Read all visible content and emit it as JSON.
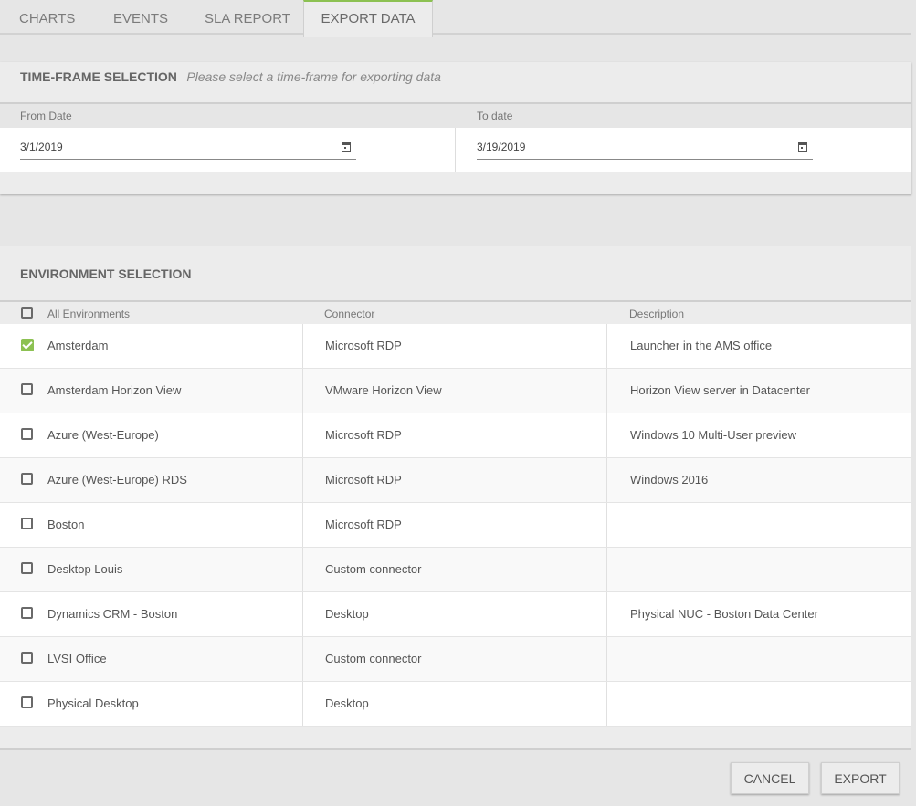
{
  "tabs": [
    {
      "label": "CHARTS"
    },
    {
      "label": "EVENTS"
    },
    {
      "label": "SLA REPORT"
    },
    {
      "label": "EXPORT DATA",
      "active": true
    }
  ],
  "time_frame": {
    "title": "TIME-FRAME SELECTION",
    "hint": "Please select a time-frame for exporting data",
    "from_label": "From Date",
    "from_value": "3/1/2019",
    "to_label": "To date",
    "to_value": "3/19/2019"
  },
  "environment": {
    "title": "ENVIRONMENT SELECTION",
    "columns": {
      "name": "All Environments",
      "connector": "Connector",
      "description": "Description"
    },
    "rows": [
      {
        "name": "Amsterdam",
        "connector": "Microsoft RDP",
        "description": "Launcher in the AMS office",
        "checked": true
      },
      {
        "name": "Amsterdam Horizon View",
        "connector": "VMware Horizon View",
        "description": "Horizon View server in Datacenter",
        "checked": false
      },
      {
        "name": "Azure (West-Europe)",
        "connector": "Microsoft RDP",
        "description": "Windows 10 Multi-User preview",
        "checked": false
      },
      {
        "name": "Azure (West-Europe) RDS",
        "connector": "Microsoft RDP",
        "description": "Windows 2016",
        "checked": false
      },
      {
        "name": "Boston",
        "connector": "Microsoft RDP",
        "description": "",
        "checked": false
      },
      {
        "name": "Desktop Louis",
        "connector": "Custom connector",
        "description": "",
        "checked": false
      },
      {
        "name": "Dynamics CRM - Boston",
        "connector": "Desktop",
        "description": "Physical NUC - Boston Data Center",
        "checked": false
      },
      {
        "name": "LVSI Office",
        "connector": "Custom connector",
        "description": "",
        "checked": false
      },
      {
        "name": "Physical Desktop",
        "connector": "Desktop",
        "description": "",
        "checked": false
      }
    ]
  },
  "actions": {
    "cancel_label": "CANCEL",
    "export_label": "EXPORT"
  },
  "colors": {
    "accent": "#8cc152"
  }
}
